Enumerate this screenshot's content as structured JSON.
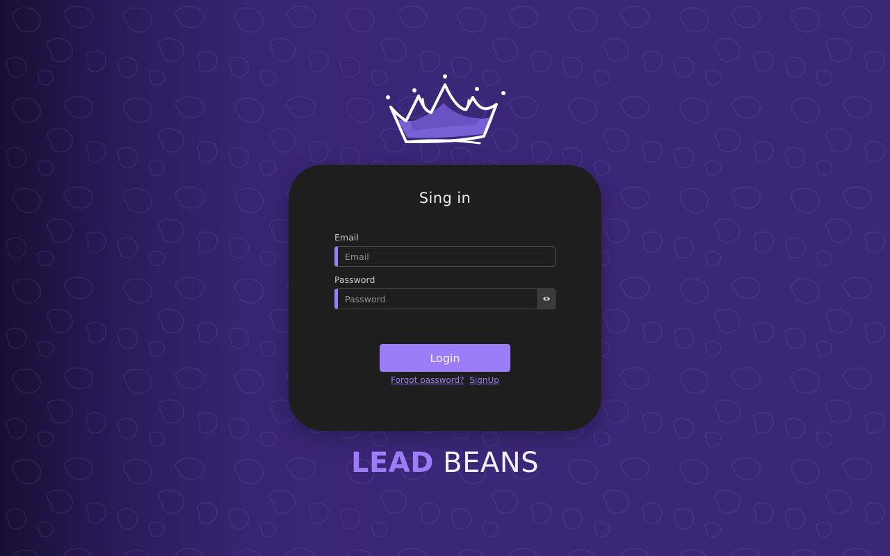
{
  "card": {
    "title": "Sing in"
  },
  "email": {
    "label": "Email",
    "placeholder": "Email",
    "value": ""
  },
  "password": {
    "label": "Password",
    "placeholder": "Password",
    "value": "",
    "toggle_icon": "eye-icon"
  },
  "actions": {
    "login_label": "Login",
    "forgot_label": "Forgot password?",
    "signup_label": "SignUp"
  },
  "brand": {
    "word1": "LEAD",
    "word2": "BEANS"
  },
  "colors": {
    "accent": "#9b7df7",
    "card_bg": "#1e1e1e",
    "page_bg": "#3b2778"
  }
}
